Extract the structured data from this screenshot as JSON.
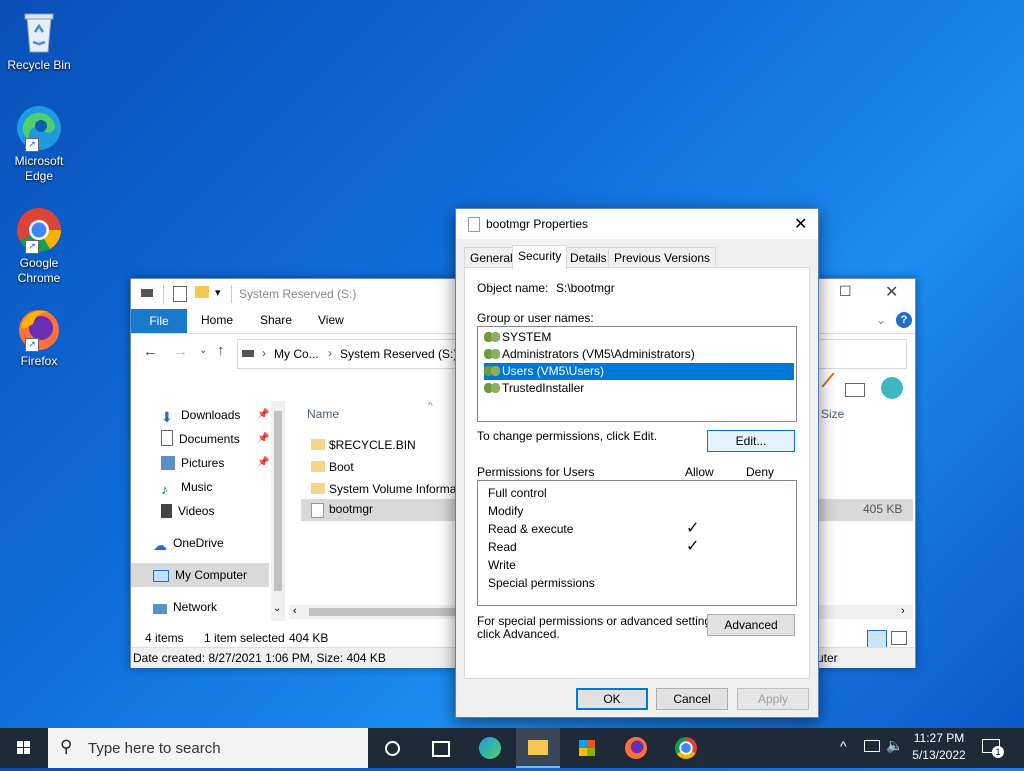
{
  "desktop": {
    "icons": [
      {
        "label": "Recycle Bin"
      },
      {
        "label": "Microsoft Edge"
      },
      {
        "label": "Google Chrome"
      },
      {
        "label": "Firefox"
      }
    ]
  },
  "explorer": {
    "title": "System Reserved (S:)",
    "ribbon_tabs": [
      "File",
      "Home",
      "Share",
      "View"
    ],
    "breadcrumb": [
      "My Co...",
      "System Reserved (S:)"
    ],
    "nav_items": [
      {
        "label": "Downloads",
        "icon": "download-arrow-icon"
      },
      {
        "label": "Documents",
        "icon": "documents-icon"
      },
      {
        "label": "Pictures",
        "icon": "pictures-icon"
      },
      {
        "label": "Music",
        "icon": "music-note-icon"
      },
      {
        "label": "Videos",
        "icon": "video-film-icon"
      },
      {
        "label": "OneDrive",
        "icon": "cloud-icon"
      },
      {
        "label": "My Computer",
        "icon": "computer-icon"
      },
      {
        "label": "Network",
        "icon": "network-icon"
      }
    ],
    "column_name": "Name",
    "column_size": "Size",
    "files": [
      {
        "name": "$RECYCLE.BIN"
      },
      {
        "name": "Boot"
      },
      {
        "name": "System Volume Informat"
      },
      {
        "name": "bootmgr",
        "size": "405 KB"
      }
    ],
    "status": {
      "count": "4 items",
      "selected": "1 item selected",
      "size": "404 KB"
    },
    "details": "Date created: 8/27/2021 1:06 PM, Size: 404 KB",
    "details_right": "uter"
  },
  "dialog": {
    "title": "bootmgr Properties",
    "tabs": [
      "General",
      "Security",
      "Details",
      "Previous Versions"
    ],
    "object_name_label": "Object name:",
    "object_name_value": "S:\\bootmgr",
    "group_label": "Group or user names:",
    "users": [
      "SYSTEM",
      "Administrators (VM5\\Administrators)",
      "Users (VM5\\Users)",
      "TrustedInstaller"
    ],
    "change_text": "To change permissions, click Edit.",
    "edit_label": "Edit...",
    "permissions_for": "Permissions for Users",
    "allow_label": "Allow",
    "deny_label": "Deny",
    "permissions": [
      {
        "name": "Full control",
        "allow": false
      },
      {
        "name": "Modify",
        "allow": false
      },
      {
        "name": "Read & execute",
        "allow": true
      },
      {
        "name": "Read",
        "allow": true
      },
      {
        "name": "Write",
        "allow": false
      },
      {
        "name": "Special permissions",
        "allow": false
      }
    ],
    "special_line1": "For special permissions or advanced settings,",
    "special_line2": "click Advanced.",
    "advanced_label": "Advanced",
    "ok_label": "OK",
    "cancel_label": "Cancel",
    "apply_label": "Apply"
  },
  "taskbar": {
    "search_placeholder": "Type here to search",
    "time": "11:27 PM",
    "date": "5/13/2022",
    "notification_count": "1"
  }
}
